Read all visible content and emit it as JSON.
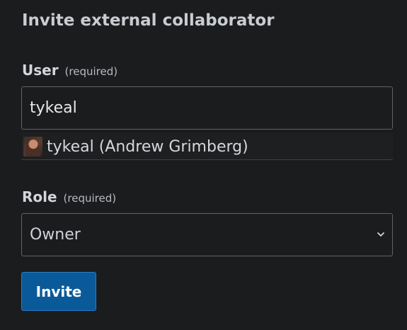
{
  "dialog": {
    "title": "Invite external collaborator"
  },
  "user_field": {
    "label": "User",
    "required_note": "(required)",
    "value": "tykeal"
  },
  "suggestions": [
    {
      "text": "tykeal (Andrew Grimberg)",
      "icon": "user-avatar"
    }
  ],
  "role_field": {
    "label": "Role",
    "required_note": "(required)",
    "selected": "Owner"
  },
  "actions": {
    "invite_label": "Invite"
  },
  "colors": {
    "background": "#1b1c1e",
    "primary_button": "#0a5a99",
    "border": "#5f6368"
  }
}
